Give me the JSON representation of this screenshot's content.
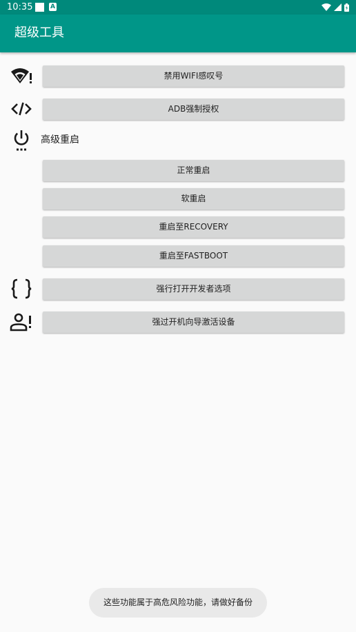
{
  "status_bar": {
    "time": "10:35",
    "notification_icon": "A"
  },
  "app_bar": {
    "title": "超级工具"
  },
  "rows": {
    "wifi": {
      "icon": "wifi-alert-icon",
      "label": "禁用WIFI感叹号"
    },
    "adb": {
      "icon": "code-icon",
      "label": "ADB强制授权"
    },
    "reboot": {
      "icon": "power-settings-icon",
      "label": "高级重启",
      "options": [
        "正常重启",
        "软重启",
        "重启至RECOVERY",
        "重启至FASTBOOT"
      ]
    },
    "developer": {
      "icon": "braces-icon",
      "label": "强行打开开发者选项"
    },
    "setup": {
      "icon": "person-alert-icon",
      "label": "强过开机向导激活设备"
    }
  },
  "toast": {
    "message": "这些功能属于高危风险功能，请做好备份"
  },
  "colors": {
    "status_bar": "#00897B",
    "app_bar": "#009688",
    "button": "#D6D7D7",
    "background": "#FAFAFA"
  }
}
